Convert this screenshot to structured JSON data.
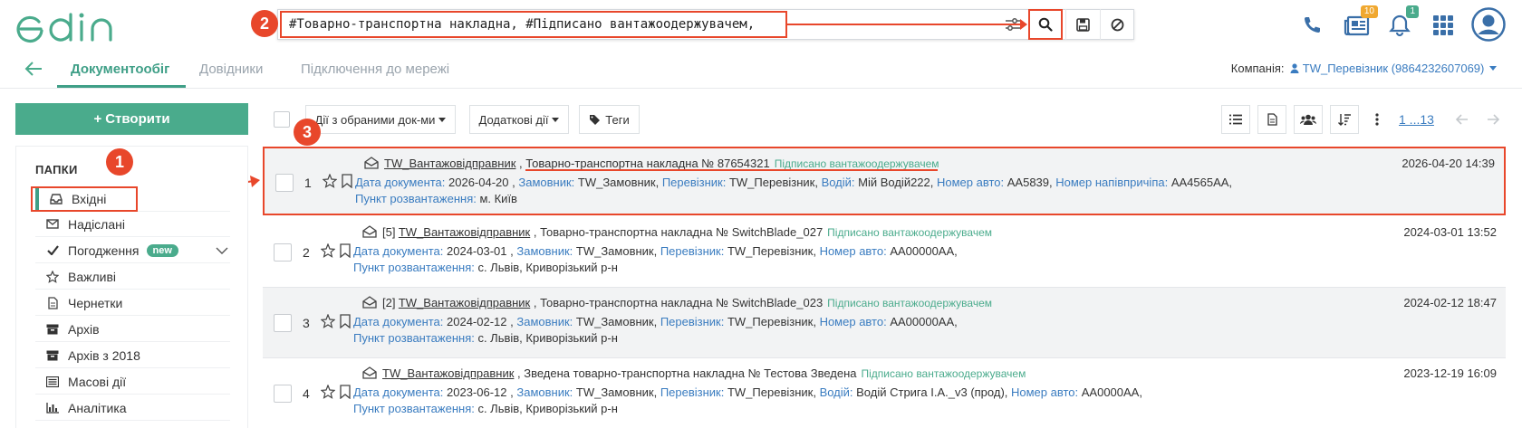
{
  "header": {
    "logo_text": "edin",
    "search_query": "#Товарно-транспортна накладна, #Підписано вантажоодержувачем,",
    "docs_badge": "10",
    "notifications_badge": "1"
  },
  "markers": [
    "1",
    "2",
    "3"
  ],
  "nav": {
    "tabs": [
      {
        "label": "Документообіг"
      },
      {
        "label": "Довідники"
      },
      {
        "label": "Підключення до мережі"
      }
    ],
    "company_label": "Компанія:",
    "company_value": "TW_Перевізник (9864232607069)"
  },
  "sidebar": {
    "create_label": "Створити",
    "folders_title": "ПАПКИ",
    "items": [
      {
        "label": "Вхідні",
        "icon": "inbox-icon"
      },
      {
        "label": "Надіслані",
        "icon": "envelope-icon"
      },
      {
        "label": "Погодження",
        "icon": "check-icon",
        "badge": "new"
      },
      {
        "label": "Важливі",
        "icon": "star-icon"
      },
      {
        "label": "Чернетки",
        "icon": "document-icon"
      },
      {
        "label": "Архів",
        "icon": "archive-icon"
      },
      {
        "label": "Архів з 2018",
        "icon": "archive-2018-icon"
      },
      {
        "label": "Масові дії",
        "icon": "mass-actions-icon"
      },
      {
        "label": "Аналітика",
        "icon": "chart-icon"
      }
    ]
  },
  "toolbar": {
    "actions_label": "Дії з обраними док-ми",
    "extra_label": "Додаткові дії",
    "tags_label": "Теги",
    "pager": "1 ...13"
  },
  "documents": [
    {
      "num": "1",
      "prefix": "",
      "sender": "TW_Вантажовідправник",
      "title": "Товарно-транспортна накладна № 87654321",
      "status": "Підписано вантажоодержувачем",
      "date": "2026-04-20 14:39",
      "line2": [
        {
          "k": "Дата документа:",
          "v": "2026-04-20 ,"
        },
        {
          "k": "Замовник:",
          "v": "TW_Замовник,"
        },
        {
          "k": "Перевізник:",
          "v": "TW_Перевізник,"
        },
        {
          "k": "Водій:",
          "v": "Мій Водій222,"
        },
        {
          "k": "Номер авто:",
          "v": "AA5839,"
        },
        {
          "k": "Номер напівпричіпа:",
          "v": "AA4565AA,"
        }
      ],
      "line3_k": "Пункт розвантаження:",
      "line3_v": "м. Київ"
    },
    {
      "num": "2",
      "prefix": "[5]",
      "sender": "TW_Вантажовідправник",
      "title": "Товарно-транспортна накладна № SwitchBlade_027",
      "status": "Підписано вантажоодержувачем",
      "date": "2024-03-01 13:52",
      "line2": [
        {
          "k": "Дата документа:",
          "v": "2024-03-01 ,"
        },
        {
          "k": "Замовник:",
          "v": "TW_Замовник,"
        },
        {
          "k": "Перевізник:",
          "v": "TW_Перевізник,"
        },
        {
          "k": "Номер авто:",
          "v": "AA00000AA,"
        }
      ],
      "line3_k": "Пункт розвантаження:",
      "line3_v": "с. Львів, Криворізький р-н"
    },
    {
      "num": "3",
      "prefix": "[2]",
      "sender": "TW_Вантажовідправник",
      "title": "Товарно-транспортна накладна № SwitchBlade_023",
      "status": "Підписано вантажоодержувачем",
      "date": "2024-02-12 18:47",
      "line2": [
        {
          "k": "Дата документа:",
          "v": "2024-02-12 ,"
        },
        {
          "k": "Замовник:",
          "v": "TW_Замовник,"
        },
        {
          "k": "Перевізник:",
          "v": "TW_Перевізник,"
        },
        {
          "k": "Номер авто:",
          "v": "AA00000AA,"
        }
      ],
      "line3_k": "Пункт розвантаження:",
      "line3_v": "с. Львів, Криворізький р-н"
    },
    {
      "num": "4",
      "prefix": "",
      "sender": "TW_Вантажовідправник",
      "title": "Зведена товарно-транспортна накладна № Тестова Зведена",
      "status": "Підписано вантажоодержувачем",
      "date": "2023-12-19 16:09",
      "line2": [
        {
          "k": "Дата документа:",
          "v": "2023-06-12 ,"
        },
        {
          "k": "Замовник:",
          "v": "TW_Замовник,"
        },
        {
          "k": "Перевізник:",
          "v": "TW_Перевізник,"
        },
        {
          "k": "Водій:",
          "v": "Водій Стрига І.А._v3 (прод),"
        },
        {
          "k": "Номер авто:",
          "v": "AA0000AA,"
        }
      ],
      "line3_k": "Пункт розвантаження:",
      "line3_v": "с. Львів, Криворізький р-н"
    }
  ],
  "colors": {
    "accent": "#4aab8c",
    "link": "#3a7cc0",
    "annotation": "#e8472b"
  }
}
